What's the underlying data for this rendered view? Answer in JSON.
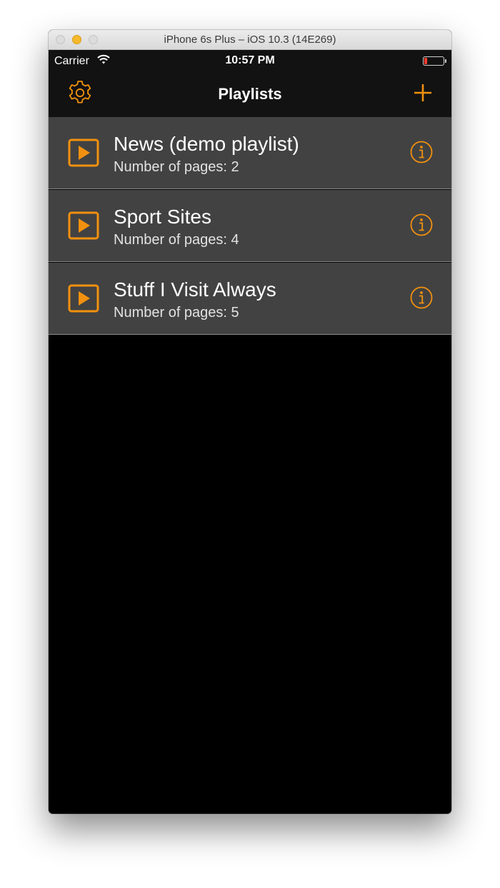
{
  "window": {
    "title": "iPhone 6s Plus – iOS 10.3 (14E269)"
  },
  "statusbar": {
    "carrier": "Carrier",
    "time": "10:57 PM",
    "battery_level": 0.15
  },
  "navbar": {
    "title": "Playlists",
    "left_icon": "gear-icon",
    "right_icon": "plus-icon"
  },
  "playlists": [
    {
      "title": "News (demo playlist)",
      "subtitle": "Number of pages: 2"
    },
    {
      "title": "Sport Sites",
      "subtitle": "Number of pages: 4"
    },
    {
      "title": "Stuff I Visit Always",
      "subtitle": "Number of pages: 5"
    }
  ],
  "colors": {
    "accent": "#F2910F",
    "row_background": "#424242",
    "bar_background": "#121212",
    "battery_low": "#FF3B30"
  }
}
